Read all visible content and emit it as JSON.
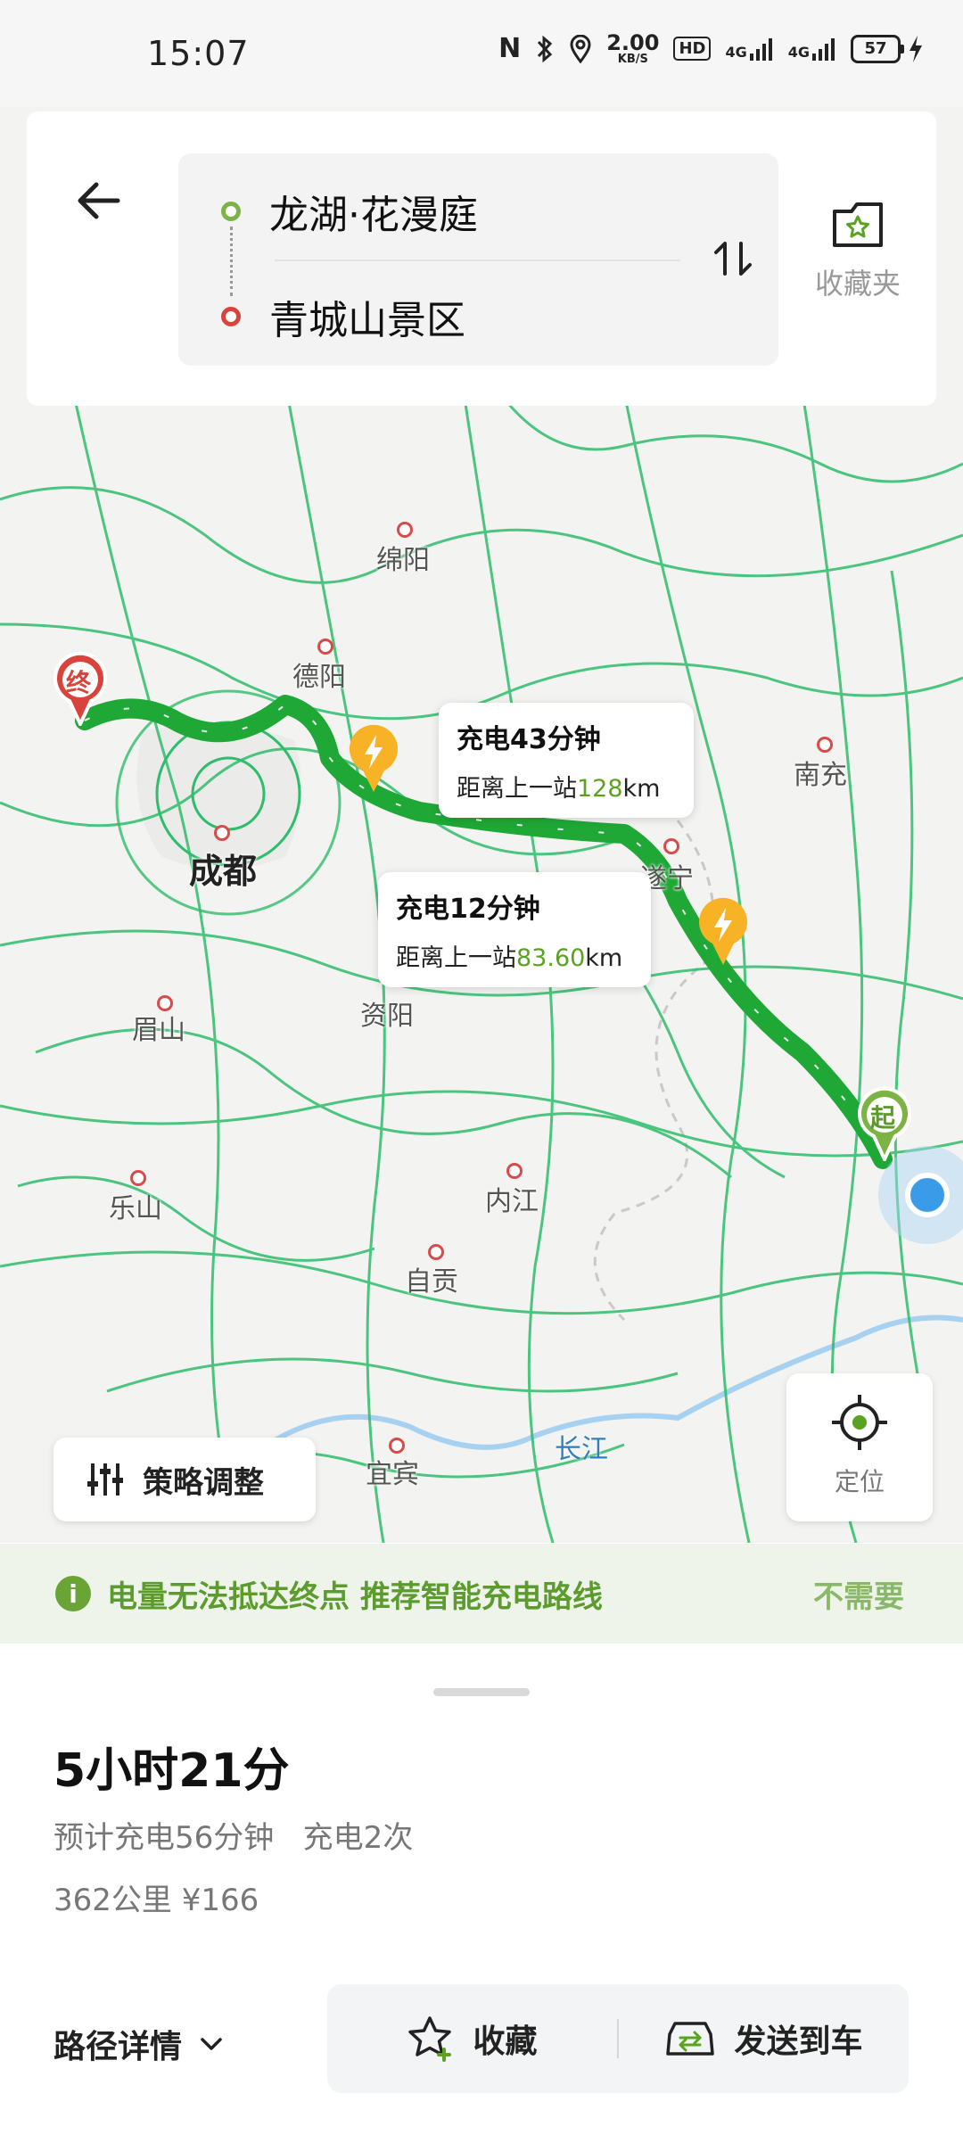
{
  "status_bar": {
    "time": "15:07",
    "net_speed_value": "2.00",
    "net_speed_unit": "KB/S",
    "hd_label": "HD",
    "signal1": "4G",
    "signal2": "4G",
    "battery": "57"
  },
  "top": {
    "origin": "龙湖·花漫庭",
    "destination": "青城山景区",
    "favorites_label": "收藏夹"
  },
  "map": {
    "cities": [
      "绵阳",
      "德阳",
      "成都",
      "眉山",
      "资阳",
      "内江",
      "乐山",
      "自贡",
      "宜宾",
      "南充",
      "遂宁"
    ],
    "river": "长江",
    "end_marker": "终",
    "start_marker": "起",
    "charge_stops": [
      {
        "title": "充电43分钟",
        "distance_prefix": "距离上一站",
        "distance_value": "128",
        "distance_unit": "km"
      },
      {
        "title": "充电12分钟",
        "distance_prefix": "距离上一站",
        "distance_value": "83.60",
        "distance_unit": "km"
      }
    ],
    "strategy_button": "策略调整",
    "locate_label": "定位"
  },
  "banner": {
    "icon": "i",
    "message": "电量无法抵达终点 推荐智能充电路线",
    "dismiss": "不需要"
  },
  "summary": {
    "duration": "5小时21分",
    "charging": "预计充电56分钟   充电2次",
    "distance_cost": "362公里 ¥166",
    "details_label": "路径详情",
    "collect_label": "收藏",
    "send_label": "发送到车"
  },
  "colors": {
    "route_green": "#1fa836",
    "road_green": "#2ebd6a",
    "accent_green": "#5aa321",
    "charge_orange": "#f7b225",
    "end_red": "#d9433b",
    "locate_blue": "#3a9ce8"
  }
}
